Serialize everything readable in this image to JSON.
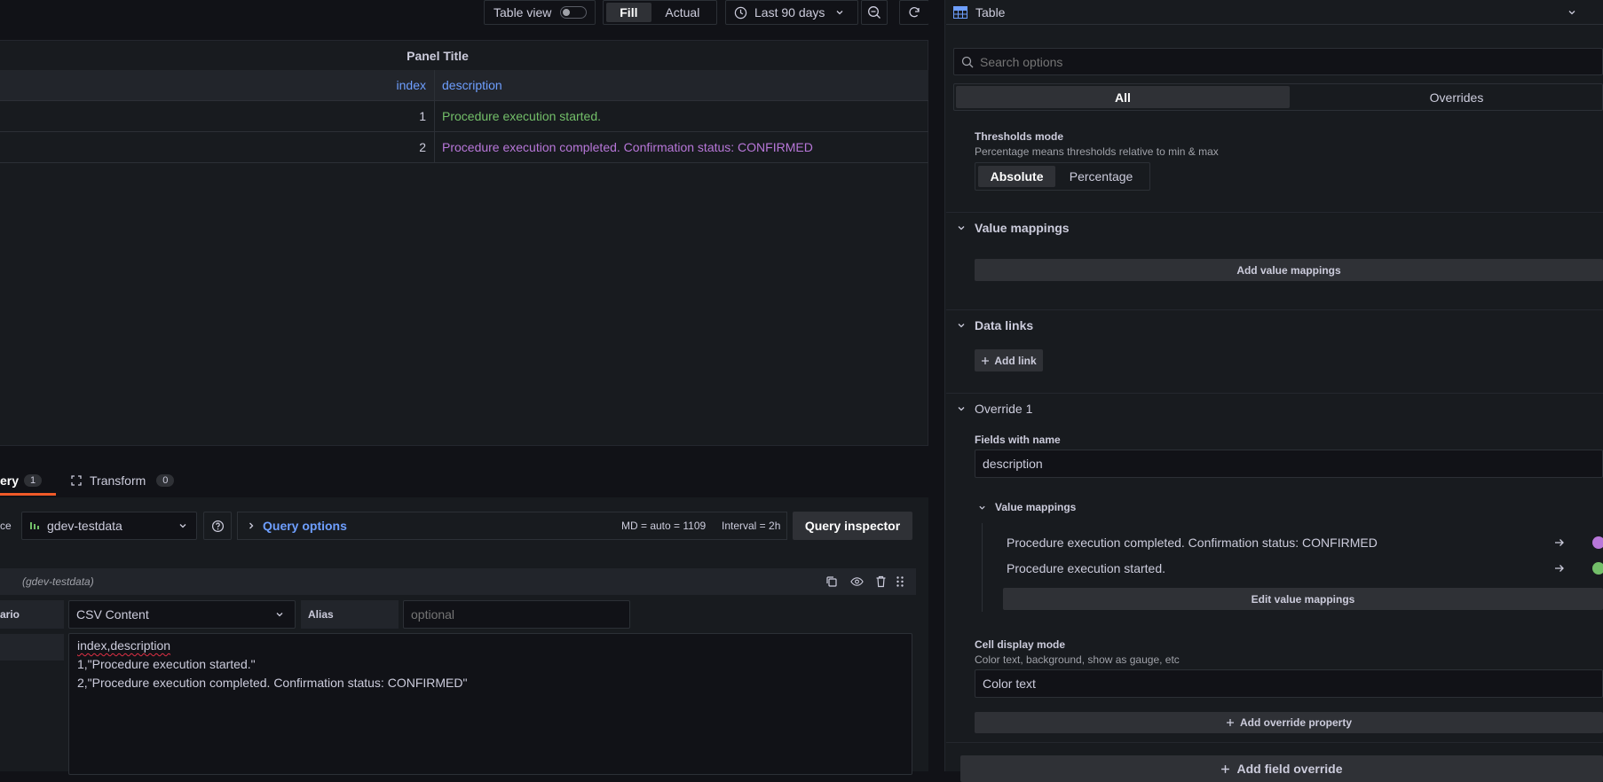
{
  "toolbar": {
    "table_view_label": "Table view",
    "table_view_on": false,
    "fill_label": "Fill",
    "actual_label": "Actual",
    "time_range": "Last 90 days"
  },
  "panel": {
    "title": "Panel Title",
    "columns": [
      "index",
      "description"
    ],
    "rows": [
      {
        "index": "1",
        "description": "Procedure execution started.",
        "color": "#73bf69"
      },
      {
        "index": "2",
        "description": "Procedure execution completed. Confirmation status: CONFIRMED",
        "color": "#b877d9"
      }
    ]
  },
  "query_tabs": {
    "query_label": "ery",
    "query_count": "1",
    "transform_label": "Transform",
    "transform_count": "0"
  },
  "query_row": {
    "ds_prefix": "ce",
    "datasource": "gdev-testdata",
    "query_options_label": "Query options",
    "md_info": "MD = auto = 1109",
    "interval_info": "Interval = 2h",
    "query_inspector_label": "Query inspector"
  },
  "query_editor": {
    "ds_hint": "(gdev-testdata)",
    "scenario_prefix": "ario",
    "scenario_value": "CSV Content",
    "alias_label": "Alias",
    "alias_placeholder": "optional",
    "csv_lines": [
      "index,description",
      "1,\"Procedure execution started.\"",
      "2,\"Procedure execution completed. Confirmation status: CONFIRMED\""
    ]
  },
  "options": {
    "viz_name": "Table",
    "search_placeholder": "Search options",
    "tab_all": "All",
    "tab_overrides": "Overrides",
    "thresholds_mode_label": "Thresholds mode",
    "thresholds_mode_desc": "Percentage means thresholds relative to min & max",
    "thresholds_absolute": "Absolute",
    "thresholds_percentage": "Percentage",
    "value_mappings_title": "Value mappings",
    "add_value_mappings": "Add value mappings",
    "data_links_title": "Data links",
    "add_link": "Add link",
    "override_title": "Override 1",
    "fields_with_name_label": "Fields with name",
    "fields_with_name_value": "description",
    "override_value_mappings": "Value mappings",
    "mappings": [
      {
        "text": "Procedure execution completed. Confirmation status: CONFIRMED",
        "color": "#b877d9"
      },
      {
        "text": "Procedure execution started.",
        "color": "#73bf69"
      }
    ],
    "edit_value_mappings": "Edit value mappings",
    "cell_display_mode_label": "Cell display mode",
    "cell_display_mode_desc": "Color text, background, show as gauge, etc",
    "cell_display_mode_value": "Color text",
    "add_override_property": "Add override property",
    "add_field_override": "Add field override"
  },
  "colors": {
    "accent_blue": "#6e9fff",
    "orange_tab": "#f05a28",
    "green": "#73bf69",
    "purple": "#b877d9"
  }
}
